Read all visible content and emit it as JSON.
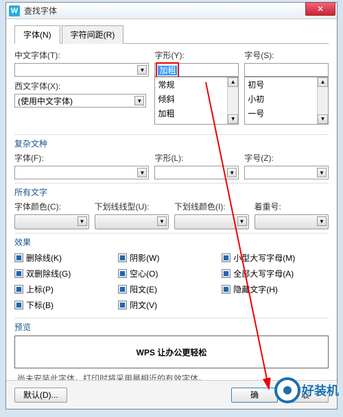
{
  "window": {
    "title": "查找字体",
    "app_icon_letter": "W"
  },
  "tabs": {
    "font": "字体(N)",
    "spacing": "字符间距(R)"
  },
  "labels": {
    "cn_font": "中文字体(T):",
    "style": "字形(Y):",
    "size": "字号(S):",
    "west_font": "西文字体(X):",
    "west_value": "(使用中文字体)",
    "complex": "复杂文种",
    "font_f": "字体(F):",
    "style_l": "字形(L):",
    "size_z": "字号(Z):",
    "all_text": "所有文字",
    "font_color": "字体颜色(C):",
    "underline_style": "下划线线型(U):",
    "underline_color": "下划线颜色(I):",
    "emphasis": "着重号:",
    "effects": "效果",
    "preview": "预览",
    "note": "尚未安装此字体，打印时将采用最相近的有效字体。"
  },
  "style_input": "加粗",
  "style_list": [
    "常规",
    "倾斜",
    "加粗"
  ],
  "size_list": [
    "初号",
    "小初",
    "一号"
  ],
  "effects_checks": {
    "strike": "删除线(K)",
    "dstrike": "双删除线(G)",
    "super": "上标(P)",
    "sub": "下标(B)",
    "shadow": "阴影(W)",
    "hollow": "空心(O)",
    "emboss": "阳文(E)",
    "engrave": "阴文(V)",
    "smallcaps": "小型大写字母(M)",
    "allcaps": "全部大写字母(A)",
    "hidden": "隐藏文字(H)"
  },
  "preview_text": "WPS 让办公更轻松",
  "footer": {
    "default_btn": "默认(D)...",
    "ok": "确",
    "cancel": "取"
  },
  "watermark": "好装机"
}
